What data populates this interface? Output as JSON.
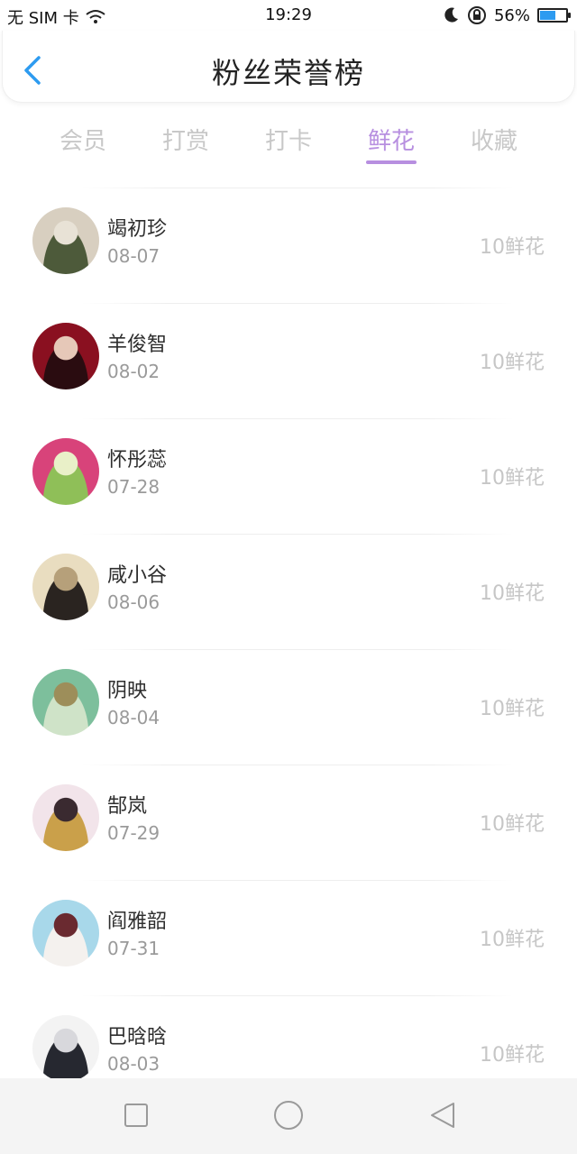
{
  "status_bar": {
    "carrier": "无 SIM 卡",
    "time": "19:29",
    "battery": "56%",
    "battery_level": 0.56
  },
  "header": {
    "title": "粉丝荣誉榜"
  },
  "tabs": [
    {
      "label": "会员",
      "active": false
    },
    {
      "label": "打赏",
      "active": false
    },
    {
      "label": "打卡",
      "active": false
    },
    {
      "label": "鲜花",
      "active": true
    },
    {
      "label": "收藏",
      "active": false
    }
  ],
  "rows": [
    {
      "name": "竭初珍",
      "date": "08-07",
      "amount": "10鲜花",
      "avatar_icon": "vintage-car-photo",
      "avatar_colors": [
        "#d8cfc0",
        "#4d5a3a",
        "#e8e2d6"
      ]
    },
    {
      "name": "羊俊智",
      "date": "08-02",
      "amount": "10鲜花",
      "avatar_icon": "couple-photo",
      "avatar_colors": [
        "#8a1020",
        "#2a0c10",
        "#e6c8b8"
      ]
    },
    {
      "name": "怀彤蕊",
      "date": "07-28",
      "amount": "10鲜花",
      "avatar_icon": "flower-photo",
      "avatar_colors": [
        "#d8437a",
        "#8fbf58",
        "#e9f0c8"
      ]
    },
    {
      "name": "咸小谷",
      "date": "08-06",
      "amount": "10鲜花",
      "avatar_icon": "person-photo",
      "avatar_colors": [
        "#e9ddc0",
        "#2a2420",
        "#b6a07a"
      ]
    },
    {
      "name": "阴映",
      "date": "08-04",
      "amount": "10鲜花",
      "avatar_icon": "bottle-photo",
      "avatar_colors": [
        "#7dbf9c",
        "#cfe3c8",
        "#9d8e5a"
      ]
    },
    {
      "name": "郜岚",
      "date": "07-29",
      "amount": "10鲜花",
      "avatar_icon": "girl-photo",
      "avatar_colors": [
        "#f2e4ea",
        "#caa04a",
        "#3a2a30"
      ]
    },
    {
      "name": "阎雅韶",
      "date": "07-31",
      "amount": "10鲜花",
      "avatar_icon": "anime-photo",
      "avatar_colors": [
        "#a8d8ea",
        "#f4f1ee",
        "#6a2a30"
      ]
    },
    {
      "name": "巴晗晗",
      "date": "08-03",
      "amount": "10鲜花",
      "avatar_icon": "dress-photo",
      "avatar_colors": [
        "#f3f3f3",
        "#262830",
        "#d8d8dc"
      ]
    }
  ],
  "nav": {
    "recent_icon": "square-icon",
    "home_icon": "circle-icon",
    "back_icon": "triangle-back-icon"
  },
  "colors": {
    "accent": "#b78fe0",
    "back_arrow": "#2d9bf0"
  }
}
